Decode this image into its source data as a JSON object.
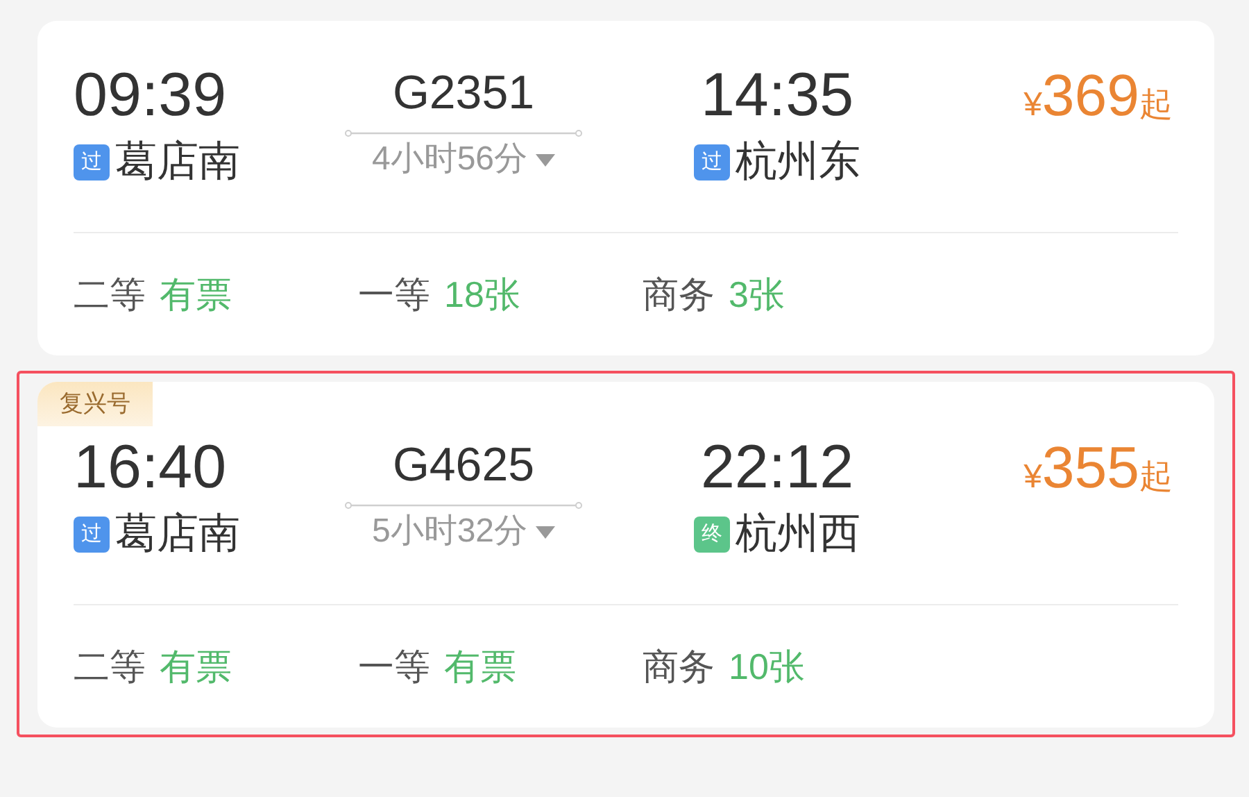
{
  "trains": [
    {
      "selected": false,
      "train_no": "G2351",
      "depart_time": "09:39",
      "depart_station": {
        "badge": "过",
        "kind": "pass",
        "name": "葛店南"
      },
      "duration": "4小时56分",
      "arrive_time": "14:35",
      "arrive_station": {
        "badge": "过",
        "kind": "pass",
        "name": "杭州东"
      },
      "price": {
        "currency": "¥",
        "amount": "369",
        "suffix": "起"
      },
      "seats": [
        {
          "class": "二等",
          "availability": "有票"
        },
        {
          "class": "一等",
          "availability": "18张"
        },
        {
          "class": "商务",
          "availability": "3张"
        }
      ]
    },
    {
      "selected": true,
      "tag": "复兴号",
      "train_no": "G4625",
      "depart_time": "16:40",
      "depart_station": {
        "badge": "过",
        "kind": "pass",
        "name": "葛店南"
      },
      "duration": "5小时32分",
      "arrive_time": "22:12",
      "arrive_station": {
        "badge": "终",
        "kind": "terminal",
        "name": "杭州西"
      },
      "price": {
        "currency": "¥",
        "amount": "355",
        "suffix": "起"
      },
      "seats": [
        {
          "class": "二等",
          "availability": "有票"
        },
        {
          "class": "一等",
          "availability": "有票"
        },
        {
          "class": "商务",
          "availability": "10张"
        }
      ]
    }
  ]
}
